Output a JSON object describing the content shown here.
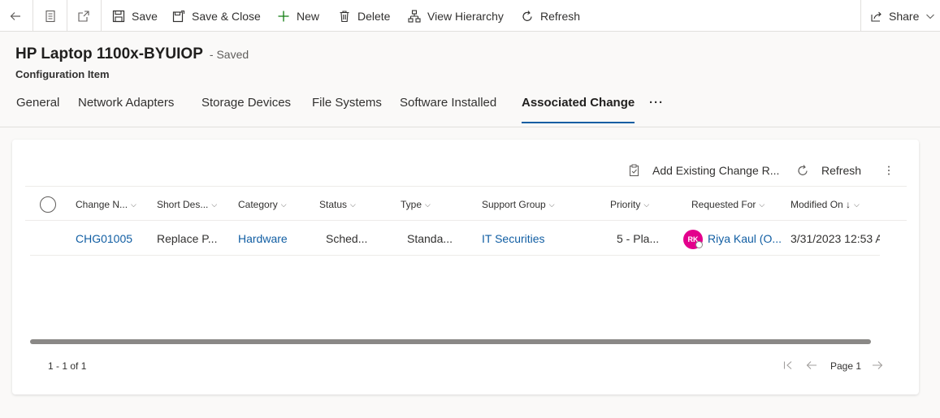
{
  "toolbar": {
    "save": "Save",
    "save_close": "Save & Close",
    "new": "New",
    "delete": "Delete",
    "view_hierarchy": "View Hierarchy",
    "refresh": "Refresh",
    "share": "Share"
  },
  "record": {
    "title": "HP Laptop 1100x-BYUIOP",
    "status": "- Saved",
    "entity": "Configuration Item"
  },
  "tabs": [
    {
      "label": "General"
    },
    {
      "label": "Network Adapters"
    },
    {
      "label": "Storage Devices"
    },
    {
      "label": "File Systems"
    },
    {
      "label": "Software Installed"
    },
    {
      "label": "Associated Change",
      "active": true
    },
    {
      "label": "···"
    }
  ],
  "grid": {
    "add_existing": "Add Existing Change R...",
    "refresh": "Refresh",
    "columns": [
      {
        "label": "Change N..."
      },
      {
        "label": "Short Des..."
      },
      {
        "label": "Category"
      },
      {
        "label": "Status"
      },
      {
        "label": "Type"
      },
      {
        "label": "Support Group"
      },
      {
        "label": "Priority"
      },
      {
        "label": "Requested For"
      },
      {
        "label": "Modified On ↓"
      }
    ],
    "rows": [
      {
        "change_number": "CHG01005",
        "short_description": "Replace P...",
        "category": "Hardware",
        "status": "Sched...",
        "type": "Standa...",
        "support_group": "IT Securities",
        "priority": "5 - Pla...",
        "avatar_initials": "RK",
        "requested_for": "Riya Kaul (O...",
        "modified_on": "3/31/2023 12:53 A"
      }
    ],
    "record_count": "1 - 1 of 1",
    "page_label": "Page 1"
  },
  "colors": {
    "link": "#115ea3",
    "avatar": "#e3008c",
    "accent": "#115ea3"
  }
}
